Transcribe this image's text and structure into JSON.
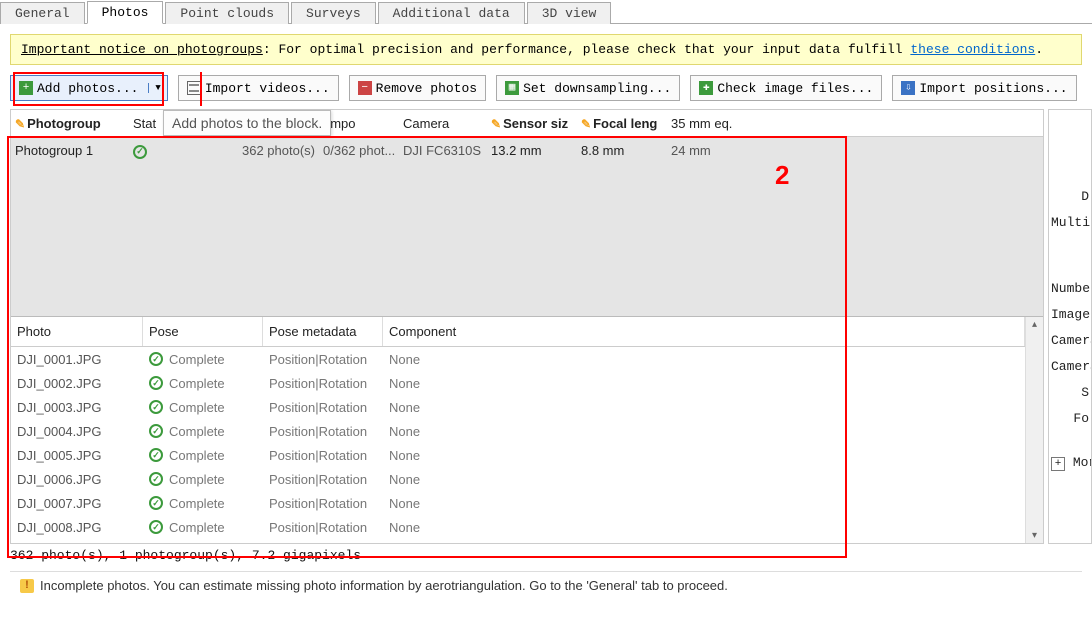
{
  "tabs": {
    "general": "General",
    "photos": "Photos",
    "point_clouds": "Point clouds",
    "surveys": "Surveys",
    "additional_data": "Additional data",
    "view_3d": "3D view"
  },
  "notice": {
    "lead": "Important notice on photogroups",
    "body": ": For optimal precision and performance, please check that your input data fulfill ",
    "link": "these conditions",
    "tail": "."
  },
  "toolbar": {
    "add_photos": "Add photos...",
    "import_videos": "Import videos...",
    "remove_photos": "Remove photos",
    "set_downsampling": "Set downsampling...",
    "check_image_files": "Check image files...",
    "import_positions": "Import positions..."
  },
  "tooltip": "Add photos to the block.",
  "pg_headers": {
    "photogroup": "Photogroup",
    "status": "Stat",
    "photos": "",
    "component": "ompo",
    "camera": "Camera",
    "sensor_size": "Sensor siz",
    "focal_length": "Focal leng",
    "eq35": "35 mm eq."
  },
  "pg_row": {
    "name": "Photogroup 1",
    "photos": "362 photo(s)",
    "comp": "0/362 phot...",
    "camera": "DJI FC6310S",
    "sensor": "13.2 mm",
    "focal": "8.8 mm",
    "eq35": "24 mm"
  },
  "photo_headers": {
    "photo": "Photo",
    "pose": "Pose",
    "pose_metadata": "Pose metadata",
    "component": "Component"
  },
  "photos": [
    {
      "name": "DJI_0001.JPG",
      "pose": "Complete",
      "meta": "Position|Rotation",
      "comp": "None"
    },
    {
      "name": "DJI_0002.JPG",
      "pose": "Complete",
      "meta": "Position|Rotation",
      "comp": "None"
    },
    {
      "name": "DJI_0003.JPG",
      "pose": "Complete",
      "meta": "Position|Rotation",
      "comp": "None"
    },
    {
      "name": "DJI_0004.JPG",
      "pose": "Complete",
      "meta": "Position|Rotation",
      "comp": "None"
    },
    {
      "name": "DJI_0005.JPG",
      "pose": "Complete",
      "meta": "Position|Rotation",
      "comp": "None"
    },
    {
      "name": "DJI_0006.JPG",
      "pose": "Complete",
      "meta": "Position|Rotation",
      "comp": "None"
    },
    {
      "name": "DJI_0007.JPG",
      "pose": "Complete",
      "meta": "Position|Rotation",
      "comp": "None"
    },
    {
      "name": "DJI_0008.JPG",
      "pose": "Complete",
      "meta": "Position|Rotation",
      "comp": "None"
    }
  ],
  "status_line": "362 photo(s), 1 photogroup(s), 7.2 gigapixels",
  "warning": "Incomplete photos. You can estimate missing photo information by aerotriangulation. Go to the 'General' tab to proceed.",
  "right_panel": {
    "l1": "D",
    "l2": "Multi-",
    "l3": "Number",
    "l4": "Image",
    "l5": "Camera",
    "l6": "Camera",
    "l7": "S",
    "l8": "Fo",
    "more": "Mor"
  },
  "annotation": {
    "num": "2"
  }
}
